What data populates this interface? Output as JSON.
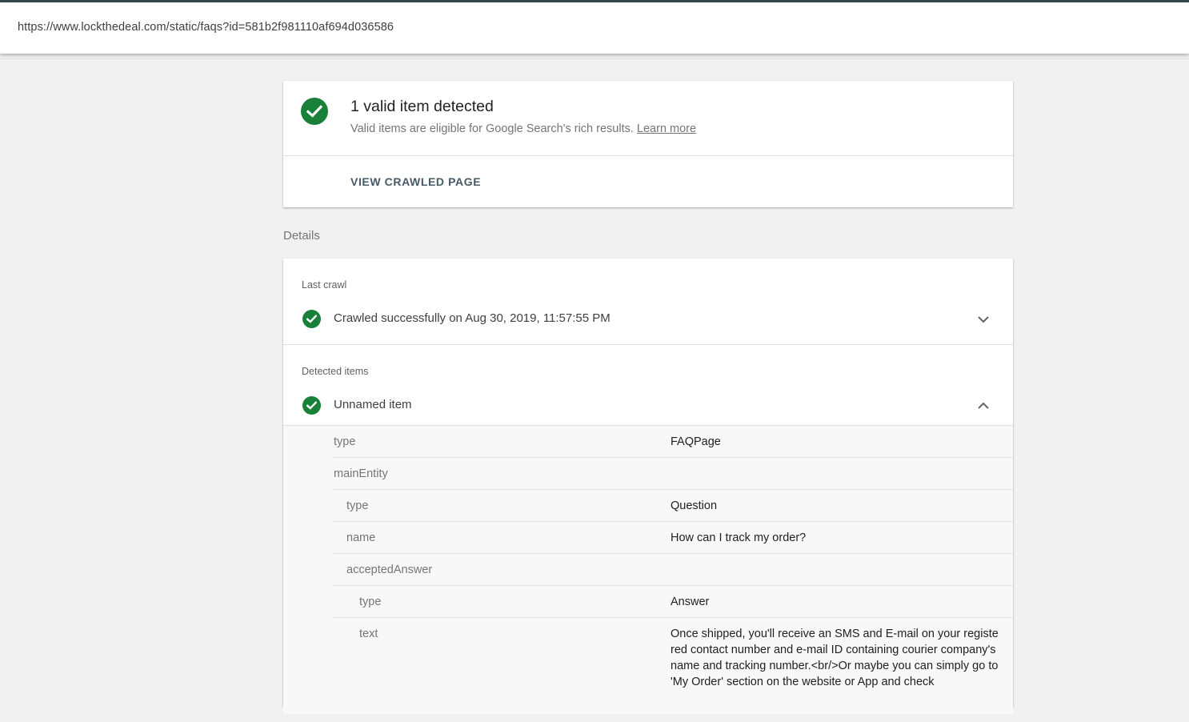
{
  "browser": {
    "url": "https://www.lockthedeal.com/static/faqs?id=581b2f981110af694d036586"
  },
  "summary": {
    "title": "1 valid item detected",
    "subtitle": "Valid items are eligible for Google Search's rich results.",
    "learn_more": "Learn more",
    "view_button": "VIEW CRAWLED PAGE",
    "status_color": "#188038"
  },
  "details": {
    "heading": "Details",
    "last_crawl": {
      "label": "Last crawl",
      "status": "Crawled successfully on Aug 30, 2019, 11:57:55 PM"
    },
    "detected_items": {
      "label": "Detected items",
      "item_name": "Unnamed item"
    },
    "properties": [
      {
        "key": "type",
        "value": "FAQPage"
      },
      {
        "key": "mainEntity",
        "value": ""
      },
      {
        "key": "type",
        "value": "Question"
      },
      {
        "key": "name",
        "value": "How can I track my order?"
      },
      {
        "key": "acceptedAnswer",
        "value": ""
      },
      {
        "key": "type",
        "value": "Answer"
      },
      {
        "key": "text",
        "value": "Once shipped, you'll receive an SMS and E-mail on your registered contact number and e-mail ID containing courier company's name and tracking number.<br/>Or maybe you can simply go to 'My Order' section on the website or App and check"
      }
    ]
  },
  "icons": {
    "check": "check-circle-icon",
    "expand": "chevron-down-icon",
    "collapse": "chevron-up-icon"
  }
}
